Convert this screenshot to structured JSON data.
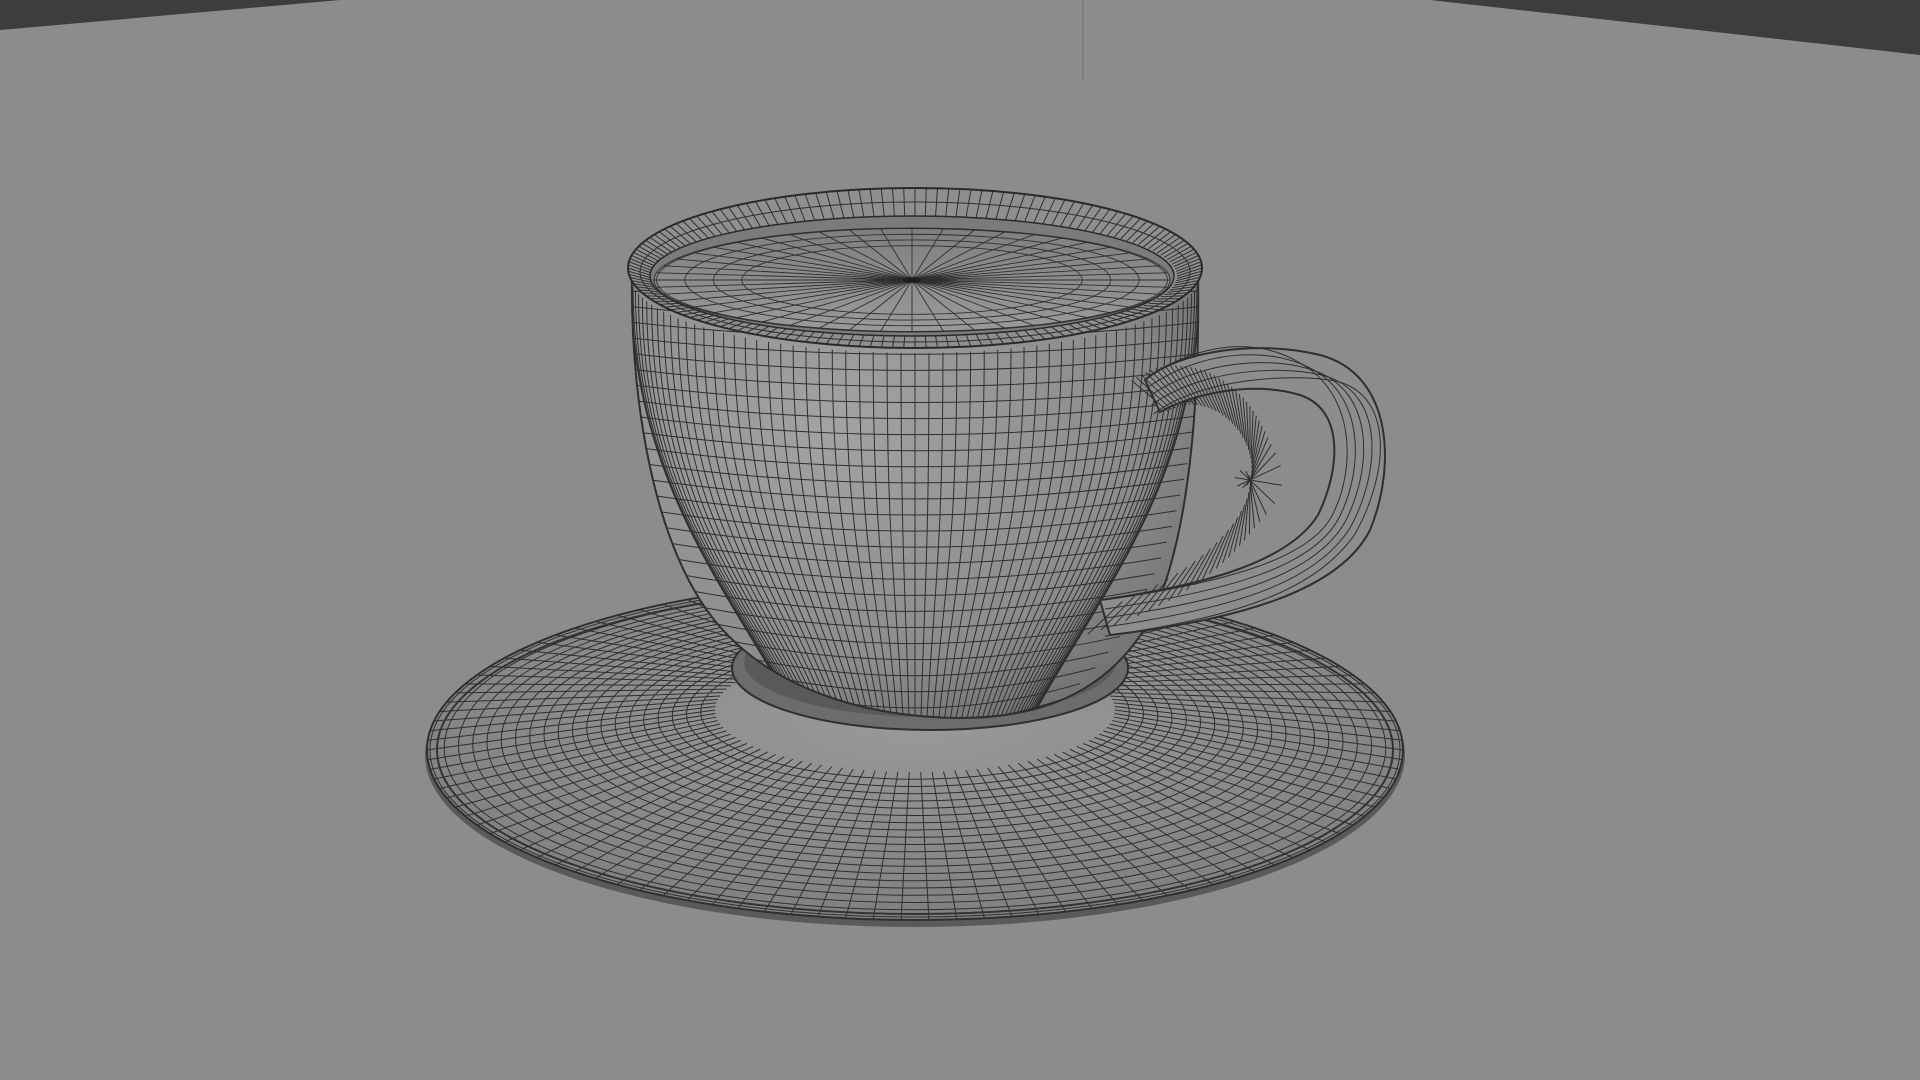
{
  "app": {
    "title": ""
  },
  "viewport": {
    "shading_mode": "solid-wireframe",
    "colors": {
      "background": "#8b8c8d",
      "corner_shadow": "#3c3d3e",
      "mesh_surface": "#8a8a8a",
      "mesh_wire": "#2f2f2f",
      "mesh_shadow": "#6e6e6e"
    },
    "objects": [
      {
        "name": "cup-mesh",
        "selected": false
      },
      {
        "name": "handle-mesh",
        "selected": false
      },
      {
        "name": "saucer-mesh",
        "selected": false
      },
      {
        "name": "liquid-surface-mesh",
        "selected": false
      }
    ]
  }
}
